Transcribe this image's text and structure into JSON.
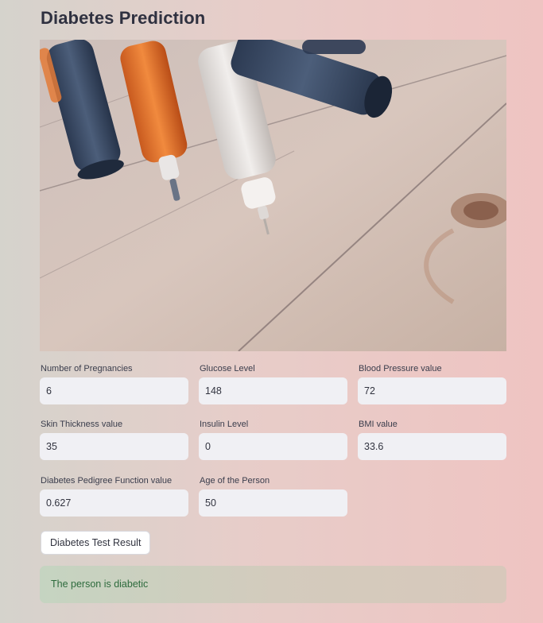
{
  "page": {
    "title": "Diabetes Prediction"
  },
  "hero_image": {
    "alt": "insulin-pens-on-wooden-table"
  },
  "fields": [
    {
      "label": "Number of Pregnancies",
      "value": "6"
    },
    {
      "label": "Glucose Level",
      "value": "148"
    },
    {
      "label": "Blood Pressure value",
      "value": "72"
    },
    {
      "label": "Skin Thickness value",
      "value": "35"
    },
    {
      "label": "Insulin Level",
      "value": "0"
    },
    {
      "label": "BMI value",
      "value": "33.6"
    },
    {
      "label": "Diabetes Pedigree Function value",
      "value": "0.627"
    },
    {
      "label": "Age of the Person",
      "value": "50"
    }
  ],
  "actions": {
    "submit_label": "Diabetes Test Result"
  },
  "result": {
    "message": "The person is diabetic"
  },
  "colors": {
    "title": "#2f3140",
    "input_bg": "#f0f0f4",
    "success_text": "#2e6b3d"
  }
}
